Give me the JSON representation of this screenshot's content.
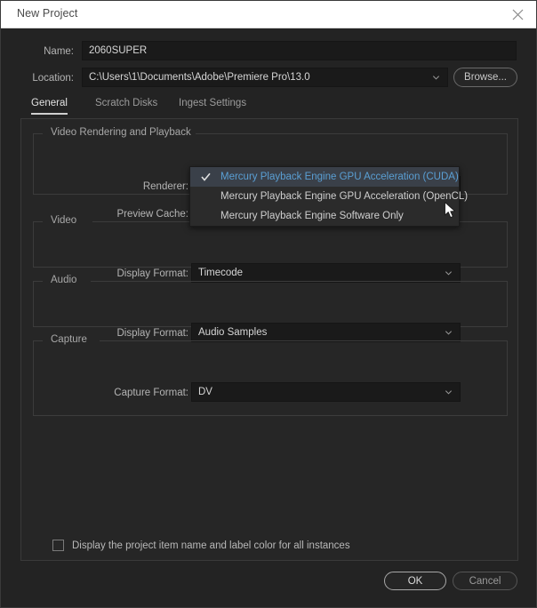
{
  "window": {
    "title": "New Project",
    "close_icon": "close-icon"
  },
  "fields": {
    "name_label": "Name:",
    "name_value": "2060SUPER",
    "name_placeholder": "",
    "location_label": "Location:",
    "location_value": "C:\\Users\\1\\Documents\\Adobe\\Premiere Pro\\13.0",
    "browse_label": "Browse..."
  },
  "tabs": [
    {
      "label": "General",
      "active": true
    },
    {
      "label": "Scratch Disks",
      "active": false
    },
    {
      "label": "Ingest Settings",
      "active": false
    }
  ],
  "groups": {
    "video_rendering": {
      "title": "Video Rendering and Playback",
      "renderer_label": "Renderer:",
      "renderer_value": "Mercury Playback Engine GPU Acceleration (CUDA)",
      "preview_cache_label": "Preview Cache:",
      "preview_cache_value": ""
    },
    "video": {
      "title": "Video",
      "display_format_label": "Display Format:",
      "display_format_value": "Timecode"
    },
    "audio": {
      "title": "Audio",
      "display_format_label": "Display Format:",
      "display_format_value": "Audio Samples"
    },
    "capture": {
      "title": "Capture",
      "capture_format_label": "Capture Format:",
      "capture_format_value": "DV"
    }
  },
  "dropdown": {
    "open": true,
    "items": [
      {
        "label": "Mercury Playback Engine GPU Acceleration (CUDA)",
        "selected": true
      },
      {
        "label": "Mercury Playback Engine GPU Acceleration (OpenCL)",
        "selected": false
      },
      {
        "label": "Mercury Playback Engine Software Only",
        "selected": false
      }
    ],
    "check_icon": "check-icon",
    "highlight_bg": "#3a4049",
    "highlight_fg": "#5a9fd4"
  },
  "checkbox": {
    "label": "Display the project item name and label color for all instances",
    "checked": false
  },
  "footer": {
    "ok_label": "OK",
    "cancel_label": "Cancel"
  },
  "cursor": {
    "icon": "mouse-pointer-icon"
  }
}
